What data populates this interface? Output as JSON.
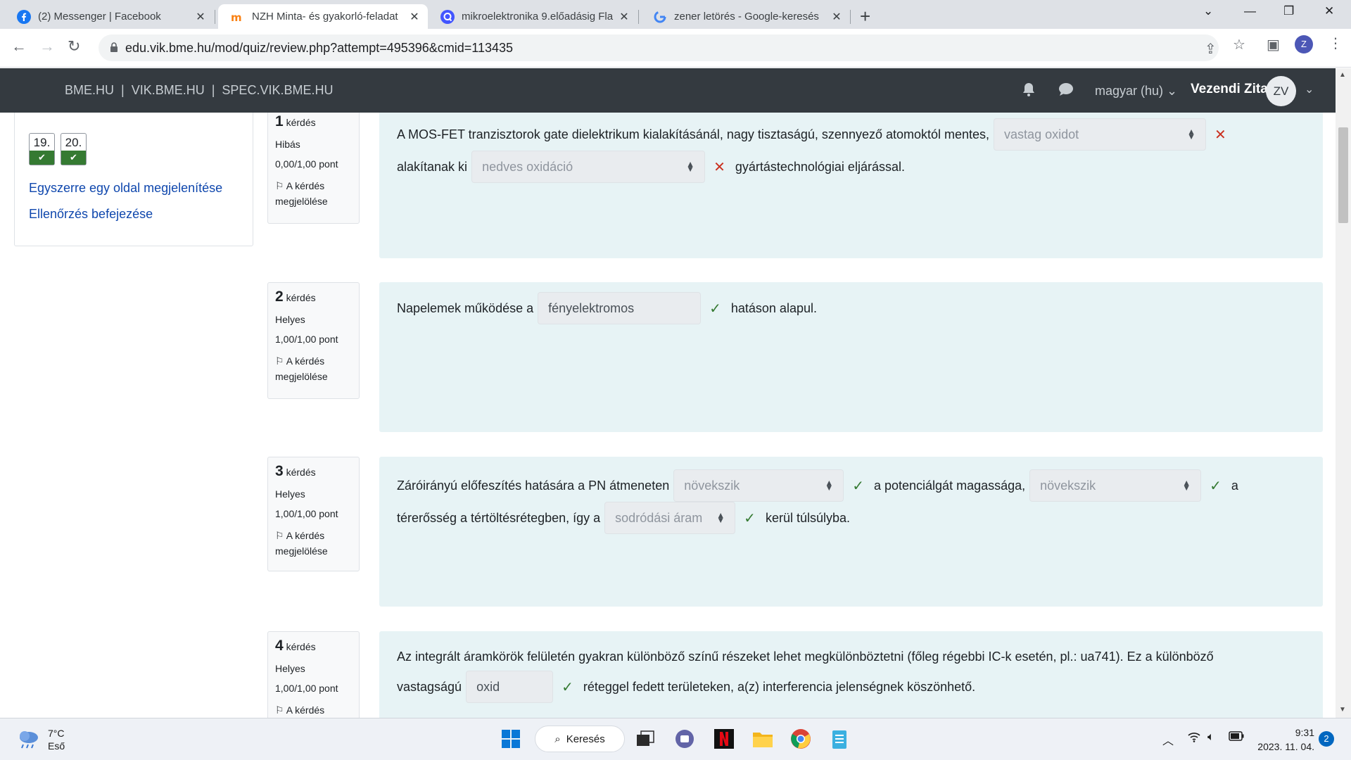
{
  "browser": {
    "tabs": [
      {
        "title": "(2) Messenger | Facebook",
        "icon": "facebook-icon",
        "active": false
      },
      {
        "title": "NZH Minta- és gyakorló-feladat",
        "icon": "moodle-icon",
        "active": true
      },
      {
        "title": "mikroelektronika 9.előadásig Fla",
        "icon": "quizlet-icon",
        "active": false
      },
      {
        "title": "zener letörés - Google-keresés",
        "icon": "google-icon",
        "active": false
      }
    ],
    "url": "edu.vik.bme.hu/mod/quiz/review.php?attempt=495396&cmid=113435",
    "profile_initial": "Z"
  },
  "navbar": {
    "links": [
      "BME.HU",
      "VIK.BME.HU",
      "SPEC.VIK.BME.HU"
    ],
    "language": "magyar (hu)",
    "user_name": "Vezendi Zita",
    "user_initials": "ZV"
  },
  "quiz_nav": {
    "top_row_states": [
      "wrong",
      "correct",
      "correct",
      "partial",
      "partial",
      "wrong"
    ],
    "buttons": [
      {
        "label": "19.",
        "state": "correct"
      },
      {
        "label": "20.",
        "state": "correct"
      }
    ],
    "links": [
      "Egyszerre egy oldal megjelenítése",
      "Ellenőrzés befejezése"
    ]
  },
  "questions": [
    {
      "number": "1",
      "label": "kérdés",
      "status": "Hibás",
      "score": "0,00/1,00 pont",
      "flag": "A kérdés megjelölése",
      "lines": [
        [
          {
            "t": "text",
            "v": "A MOS-FET tranzisztorok gate dielektrikum kialakításánál, nagy tisztaságú, szennyező atomoktól mentes,"
          },
          {
            "t": "select",
            "v": "vastag oxidot",
            "mark": "wrong"
          }
        ],
        [
          {
            "t": "text",
            "v": "alakítanak ki"
          },
          {
            "t": "select",
            "v": "nedves oxidáció",
            "mark": "wrong"
          },
          {
            "t": "text",
            "v": "gyártástechnológiai eljárással."
          }
        ]
      ]
    },
    {
      "number": "2",
      "label": "kérdés",
      "status": "Helyes",
      "score": "1,00/1,00 pont",
      "flag": "A kérdés megjelölése",
      "lines": [
        [
          {
            "t": "text",
            "v": "Napelemek működése a"
          },
          {
            "t": "input",
            "v": "fényelektromos",
            "mark": "correct"
          },
          {
            "t": "text",
            "v": "hatáson alapul."
          }
        ]
      ]
    },
    {
      "number": "3",
      "label": "kérdés",
      "status": "Helyes",
      "score": "1,00/1,00 pont",
      "flag": "A kérdés megjelölése",
      "lines": [
        [
          {
            "t": "text",
            "v": "Záróirányú előfeszítés hatására a PN átmeneten"
          },
          {
            "t": "select",
            "v": "növekszik",
            "mark": "correct"
          },
          {
            "t": "text",
            "v": "a potenciálgát magassága,"
          },
          {
            "t": "select",
            "v": "növekszik",
            "mark": "correct"
          },
          {
            "t": "text",
            "v": "a"
          }
        ],
        [
          {
            "t": "text",
            "v": "térerősség a tértöltésrétegben, így a"
          },
          {
            "t": "select",
            "v": "sodródási áram",
            "mark": "correct"
          },
          {
            "t": "text",
            "v": "kerül túlsúlyba."
          }
        ]
      ]
    },
    {
      "number": "4",
      "label": "kérdés",
      "status": "Helyes",
      "score": "1,00/1,00 pont",
      "flag": "A kérdés",
      "lines": [
        [
          {
            "t": "text",
            "v": "Az integrált áramkörök felületén gyakran különböző színű részeket lehet megkülönböztetni (főleg régebbi IC-k esetén, pl.: ua741). Ez a különböző"
          }
        ],
        [
          {
            "t": "text",
            "v": "vastagságú"
          },
          {
            "t": "input",
            "v": "oxid",
            "mark": "correct"
          },
          {
            "t": "text",
            "v": "réteggel fedett területeken, a(z) interferencia jelenségnek köszönhető."
          }
        ]
      ]
    }
  ],
  "taskbar": {
    "weather_temp": "7°C",
    "weather_desc": "Eső",
    "search_label": "Keresés",
    "time": "9:31",
    "date": "2023. 11. 04.",
    "notifications": "2"
  }
}
